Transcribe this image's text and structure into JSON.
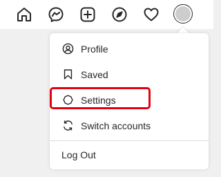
{
  "nav": {
    "icons": [
      "home-icon",
      "messenger-icon",
      "new-post-icon",
      "explore-icon",
      "activity-heart-icon",
      "profile-avatar"
    ]
  },
  "menu": {
    "items": [
      {
        "label": "Profile",
        "icon": "user-circle-icon"
      },
      {
        "label": "Saved",
        "icon": "bookmark-icon"
      },
      {
        "label": "Settings",
        "icon": "gear-icon"
      },
      {
        "label": "Switch accounts",
        "icon": "switch-accounts-icon"
      }
    ],
    "logout_label": "Log Out"
  },
  "colors": {
    "text": "#262626",
    "highlight": "#e3000f",
    "divider": "#dbdbdb"
  }
}
